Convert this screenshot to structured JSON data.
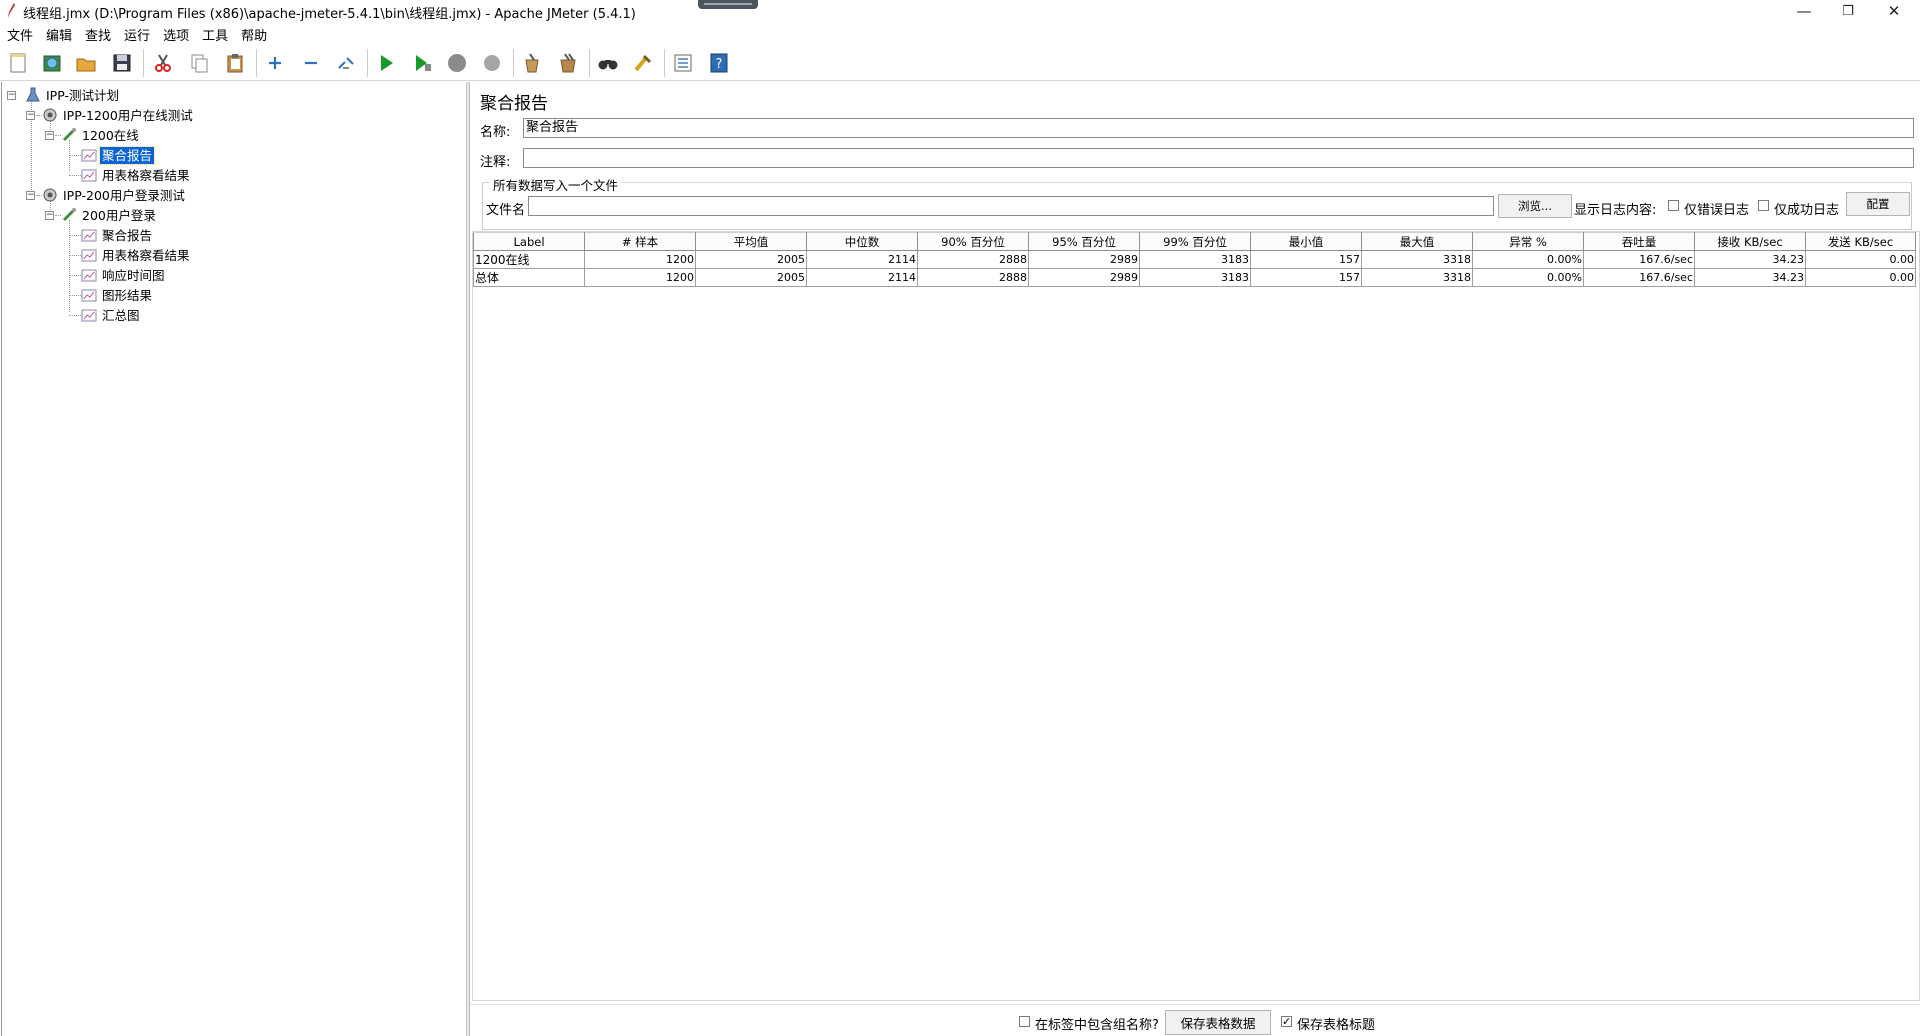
{
  "window": {
    "title": "线程组.jmx (D:\\Program Files (x86)\\apache-jmeter-5.4.1\\bin\\线程组.jmx) - Apache JMeter (5.4.1)",
    "minimize_glyph": "—",
    "restore_glyph": "❐",
    "close_glyph": "✕"
  },
  "menubar": {
    "items": [
      "文件",
      "编辑",
      "查找",
      "运行",
      "选项",
      "工具",
      "帮助"
    ]
  },
  "toolbar": {
    "buttons": [
      {
        "icon": "new-file-icon"
      },
      {
        "icon": "templates-icon"
      },
      {
        "icon": "open-folder-icon"
      },
      {
        "icon": "save-icon"
      },
      {
        "icon": "cut-icon"
      },
      {
        "icon": "copy-icon"
      },
      {
        "icon": "paste-icon"
      },
      {
        "icon": "expand-icon"
      },
      {
        "icon": "collapse-icon"
      },
      {
        "icon": "toggle-icon"
      },
      {
        "icon": "start-icon"
      },
      {
        "icon": "start-no-pauses-icon"
      },
      {
        "icon": "stop-icon"
      },
      {
        "icon": "shutdown-icon"
      },
      {
        "icon": "clear-icon"
      },
      {
        "icon": "clear-all-icon"
      },
      {
        "icon": "search-binoculars-icon"
      },
      {
        "icon": "reset-search-icon"
      },
      {
        "icon": "function-helper-icon"
      },
      {
        "icon": "help-icon"
      }
    ]
  },
  "tree": {
    "nodes": [
      {
        "label": "IPP-测试计划",
        "icon": "test-plan-icon",
        "level": 0,
        "toggle": "−"
      },
      {
        "label": "IPP-1200用户在线测试",
        "icon": "thread-group-icon",
        "level": 1,
        "toggle": "−"
      },
      {
        "label": "1200在线",
        "icon": "sampler-icon",
        "level": 2,
        "toggle": "−"
      },
      {
        "label": "聚合报告",
        "icon": "listener-icon",
        "level": 3,
        "selected": true
      },
      {
        "label": "用表格察看结果",
        "icon": "listener-icon",
        "level": 3
      },
      {
        "label": "IPP-200用户登录测试",
        "icon": "thread-group-icon",
        "level": 1,
        "toggle": "−"
      },
      {
        "label": "200用户登录",
        "icon": "sampler-icon",
        "level": 2,
        "toggle": "−"
      },
      {
        "label": "聚合报告",
        "icon": "listener-icon",
        "level": 3
      },
      {
        "label": "用表格察看结果",
        "icon": "listener-icon",
        "level": 3
      },
      {
        "label": "响应时间图",
        "icon": "listener-icon",
        "level": 3
      },
      {
        "label": "图形结果",
        "icon": "listener-icon",
        "level": 3
      },
      {
        "label": "汇总图",
        "icon": "listener-icon",
        "level": 3
      }
    ]
  },
  "panel": {
    "title": "聚合报告",
    "name_label": "名称:",
    "name_value": "聚合报告",
    "comment_label": "注释:",
    "comment_value": "",
    "file_section_legend": "所有数据写入一个文件",
    "filename_label": "文件名",
    "filename_value": "",
    "browse_button": "浏览...",
    "log_display_label": "显示日志内容:",
    "errors_only_label": "仅错误日志",
    "successes_only_label": "仅成功日志",
    "configure_button": "配置"
  },
  "table": {
    "columns": [
      "Label",
      "# 样本",
      "平均值",
      "中位数",
      "90% 百分位",
      "95% 百分位",
      "99% 百分位",
      "最小值",
      "最大值",
      "异常 %",
      "吞吐量",
      "接收 KB/sec",
      "发送 KB/sec"
    ],
    "rows": [
      [
        "1200在线",
        "1200",
        "2005",
        "2114",
        "2888",
        "2989",
        "3183",
        "157",
        "3318",
        "0.00%",
        "167.6/sec",
        "34.23",
        "0.00"
      ],
      [
        "总体",
        "1200",
        "2005",
        "2114",
        "2888",
        "2989",
        "3183",
        "157",
        "3318",
        "0.00%",
        "167.6/sec",
        "34.23",
        "0.00"
      ]
    ]
  },
  "bottom": {
    "include_group_label": "在标签中包含组名称?",
    "include_group_checked": false,
    "save_table_data_button": "保存表格数据",
    "save_table_header_label": "保存表格标题",
    "save_table_header_checked": true,
    "checked_glyph": "✓"
  },
  "colors": {
    "selection": "#0a64d6",
    "start_green": "#1a9a2a",
    "stop_gray": "#8a8a8a"
  }
}
